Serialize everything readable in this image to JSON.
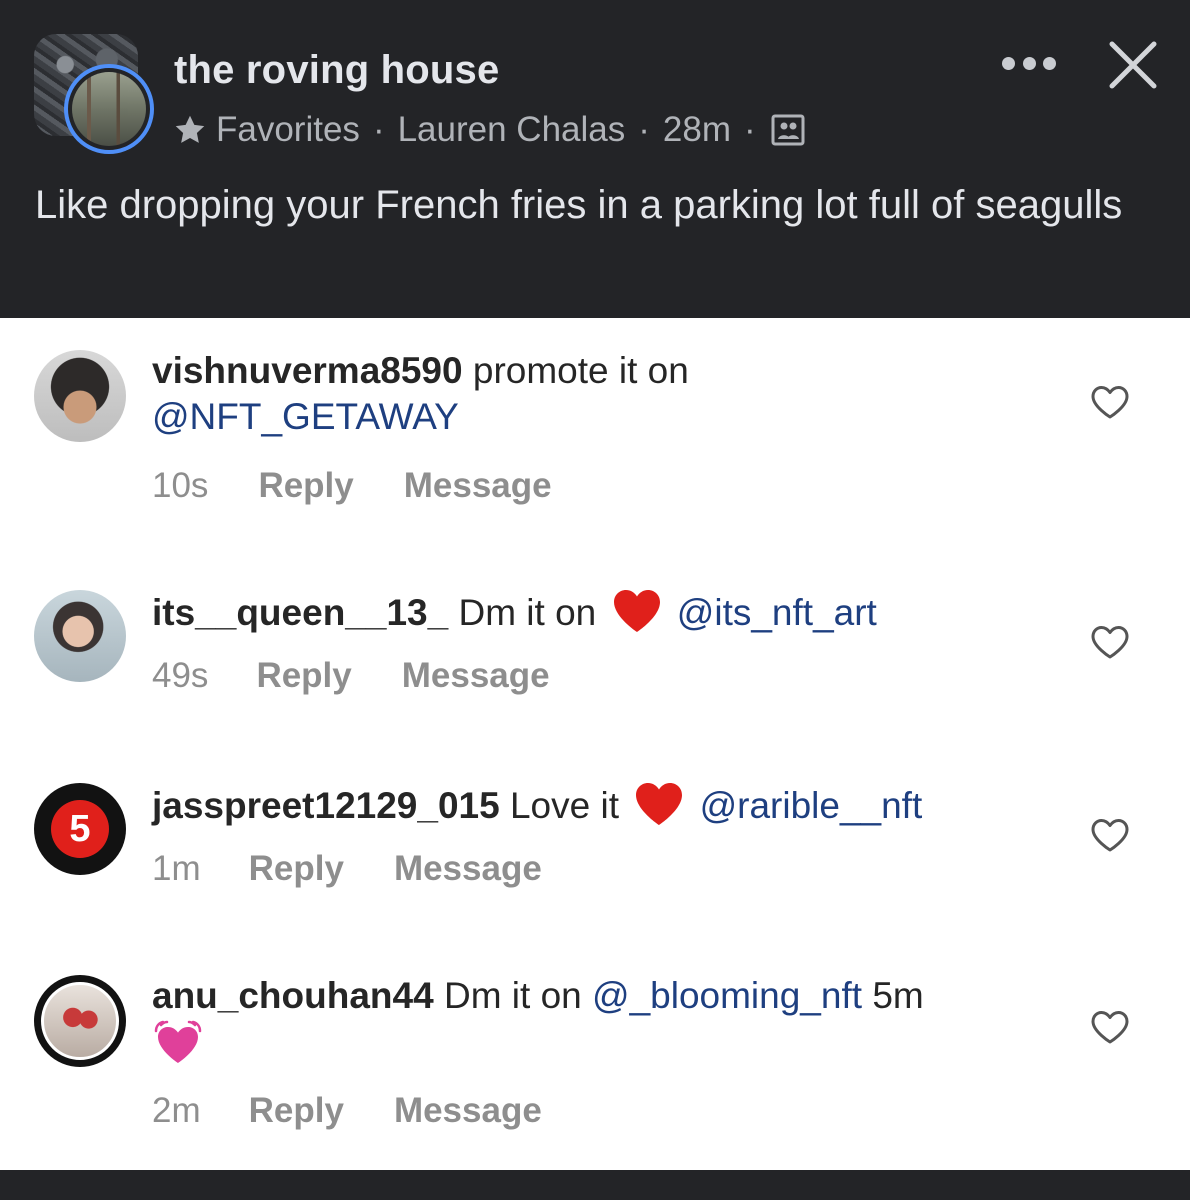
{
  "post": {
    "page_name": "the roving house",
    "audience": "Favorites",
    "separator": "·",
    "author": "Lauren Chalas",
    "time": "28m",
    "text": "Like dropping your French fries in a parking lot full of seagulls"
  },
  "icons": {
    "star": "star-icon",
    "photo": "photo-icon",
    "more": "more-horizontal-icon",
    "close": "close-icon",
    "heart": "heart-outline-icon"
  },
  "colors": {
    "header_bg": "#232427",
    "avatar_ring": "#4f8ff7",
    "mention": "#1e3f80",
    "red_heart": "#e0201b",
    "pink_heart": "#e0409a"
  },
  "comments": [
    {
      "username": "vishnuverma8590",
      "text": "promote it on",
      "mention": "@NFT_GETAWAY",
      "time": "10s",
      "reply": "Reply",
      "message": "Message"
    },
    {
      "username": "its__queen__13_",
      "text": "Dm it on",
      "emoji": "red-heart",
      "mention": "@its_nft_art",
      "time": "49s",
      "reply": "Reply",
      "message": "Message"
    },
    {
      "username": "jasspreet12129_015",
      "text": "Love it",
      "emoji": "red-heart",
      "mention": "@rarible__nft",
      "avatar_badge": "5",
      "time": "1m",
      "reply": "Reply",
      "message": "Message"
    },
    {
      "username": "anu_chouhan44",
      "text": "Dm it on",
      "mention": "@_blooming_nft",
      "suffix": "5m",
      "emoji": "pink-heart",
      "time": "2m",
      "reply": "Reply",
      "message": "Message"
    }
  ]
}
